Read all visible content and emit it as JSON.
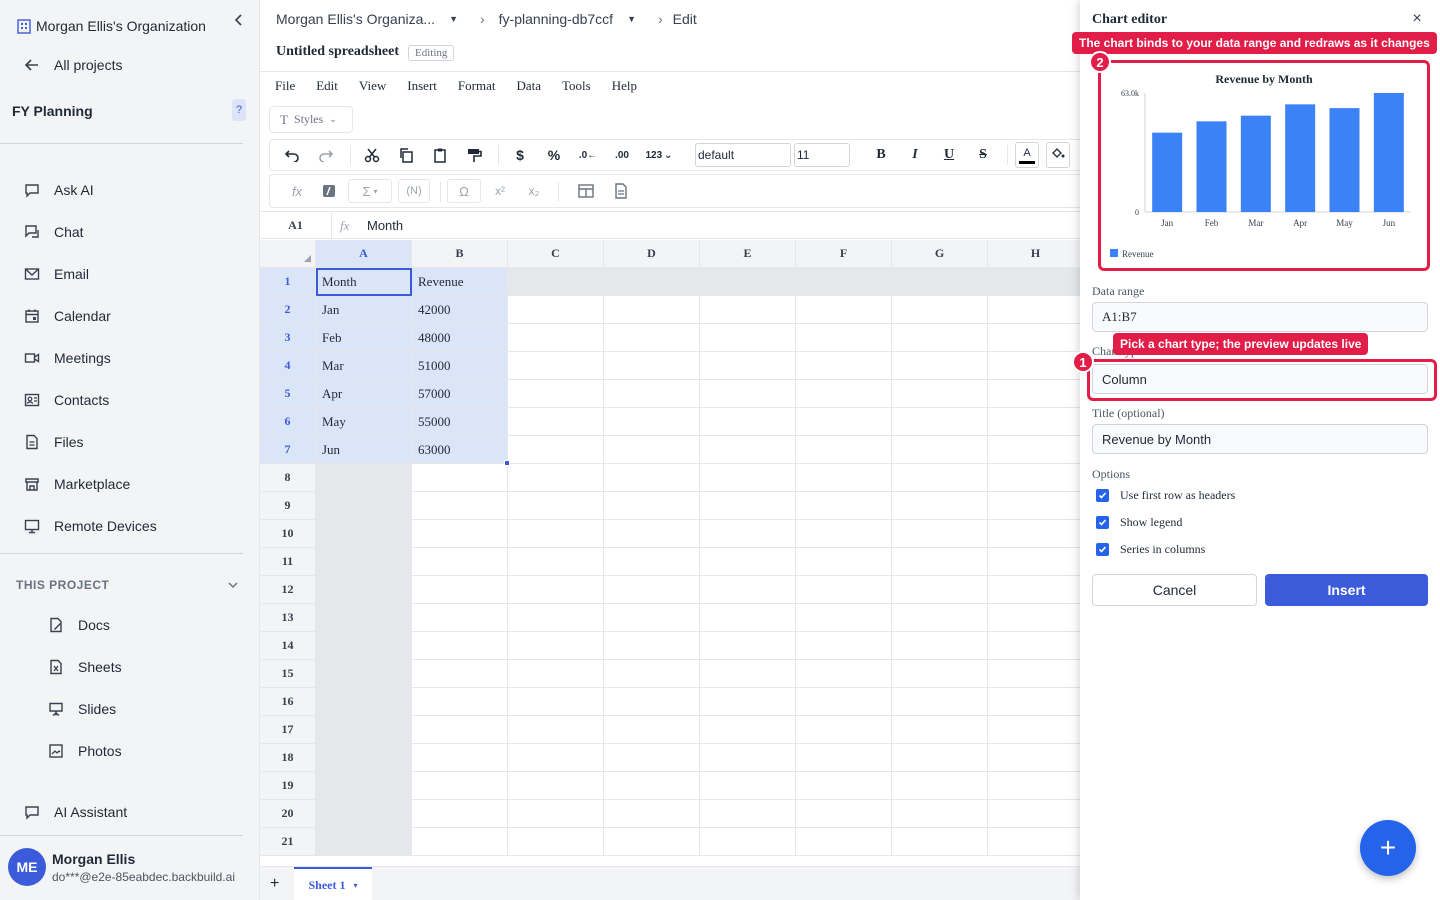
{
  "sidebar": {
    "org_name": "Morgan Ellis's Organization",
    "all_projects": "All projects",
    "project_title": "FY Planning",
    "project_help": "?",
    "main_items": [
      {
        "label": "Ask AI",
        "icon": "ask-ai-icon"
      },
      {
        "label": "Chat",
        "icon": "chat-icon"
      },
      {
        "label": "Email",
        "icon": "email-icon"
      },
      {
        "label": "Calendar",
        "icon": "calendar-icon"
      },
      {
        "label": "Meetings",
        "icon": "video-icon"
      },
      {
        "label": "Contacts",
        "icon": "contacts-icon"
      },
      {
        "label": "Files",
        "icon": "files-icon"
      },
      {
        "label": "Marketplace",
        "icon": "store-icon"
      },
      {
        "label": "Remote Devices",
        "icon": "monitor-icon"
      }
    ],
    "section_label": "THIS PROJECT",
    "project_items": [
      {
        "label": "Docs",
        "icon": "docs-icon"
      },
      {
        "label": "Sheets",
        "icon": "sheets-icon"
      },
      {
        "label": "Slides",
        "icon": "slides-icon"
      },
      {
        "label": "Photos",
        "icon": "photos-icon"
      }
    ],
    "ai_assistant": "AI Assistant",
    "user": {
      "initials": "ME",
      "name": "Morgan Ellis",
      "email": "do***@e2e-85eabdec.backbuild.ai"
    }
  },
  "header": {
    "breadcrumb": [
      "Morgan Ellis's Organiza...",
      "fy-planning-db7ccf",
      "Edit"
    ],
    "doc_title": "Untitled spreadsheet",
    "status": "Editing"
  },
  "menubar": [
    "File",
    "Edit",
    "View",
    "Insert",
    "Format",
    "Data",
    "Tools",
    "Help"
  ],
  "toolbar": {
    "styles_label": "Styles",
    "font_family": "default",
    "font_size": "11",
    "number_format": "123",
    "bold": "B",
    "italic": "I",
    "underline": "U",
    "strike": "S",
    "text_color_glyph": "A",
    "sum_glyph": "Σ",
    "named_glyph": "(N)",
    "omega_glyph": "Ω",
    "fx_glyph": "fx"
  },
  "formula_bar": {
    "cell_ref": "A1",
    "value": "Month"
  },
  "grid": {
    "columns": [
      "A",
      "B",
      "C",
      "D",
      "E",
      "F",
      "G",
      "H"
    ],
    "rows": [
      "1",
      "2",
      "3",
      "4",
      "5",
      "6",
      "7",
      "8",
      "9",
      "10",
      "11",
      "12",
      "13",
      "14",
      "15",
      "16",
      "17",
      "18",
      "19",
      "20",
      "21"
    ],
    "cells": [
      [
        "Month",
        "Revenue"
      ],
      [
        "Jan",
        "42000"
      ],
      [
        "Feb",
        "48000"
      ],
      [
        "Mar",
        "51000"
      ],
      [
        "Apr",
        "57000"
      ],
      [
        "May",
        "55000"
      ],
      [
        "Jun",
        "63000"
      ]
    ]
  },
  "sheet_tabs": [
    {
      "label": "Sheet 1"
    }
  ],
  "editor": {
    "title": "Chart editor",
    "close": "×",
    "data_range_label": "Data range",
    "data_range_value": "A1:B7",
    "chart_type_label": "Chart type",
    "chart_type_value": "Column",
    "title_label": "Title (optional)",
    "title_value": "Revenue by Month",
    "options_label": "Options",
    "options": [
      {
        "label": "Use first row as headers",
        "checked": true
      },
      {
        "label": "Show legend",
        "checked": true
      },
      {
        "label": "Series in columns",
        "checked": true
      }
    ],
    "cancel": "Cancel",
    "insert": "Insert"
  },
  "annotations": [
    {
      "number": "2",
      "text": "The chart binds to your data range and redraws as it changes"
    },
    {
      "number": "1",
      "text": "Pick a chart type; the preview updates live"
    }
  ],
  "fab_glyph": "+",
  "colors": {
    "accent": "#3b5bdb",
    "highlight": "#e11d48",
    "bar": "#3b82f6",
    "selection": "#dbe5f8"
  },
  "chart_data": {
    "type": "bar",
    "title": "Revenue by Month",
    "categories": [
      "Jan",
      "Feb",
      "Mar",
      "Apr",
      "May",
      "Jun"
    ],
    "series": [
      {
        "name": "Revenue",
        "values": [
          42000,
          48000,
          51000,
          57000,
          55000,
          63000
        ]
      }
    ],
    "ylim": [
      0,
      63000
    ],
    "ytick_labels": [
      "0",
      "63.0k"
    ],
    "legend": "bottom-left",
    "grid": false
  }
}
